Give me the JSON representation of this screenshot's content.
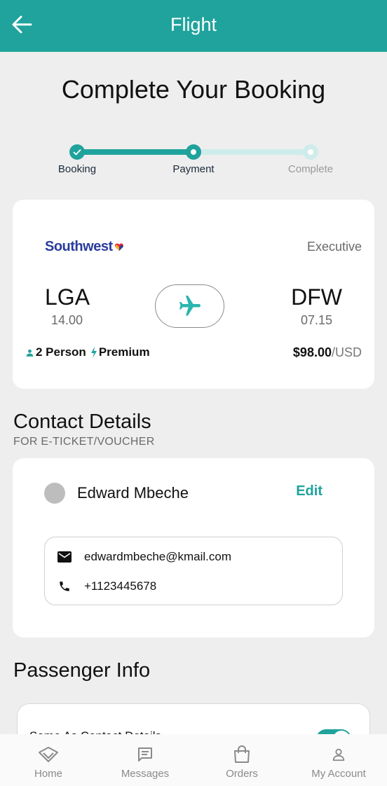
{
  "appbar": {
    "title": "Flight",
    "back_icon": "arrow-left-icon"
  },
  "page_title": "Complete Your Booking",
  "stepper": {
    "steps": [
      {
        "label": "Booking",
        "state": "done"
      },
      {
        "label": "Payment",
        "state": "current"
      },
      {
        "label": "Complete",
        "state": "pending"
      }
    ]
  },
  "flight": {
    "airline": "Southwest",
    "cabin_class": "Executive",
    "from": {
      "code": "LGA",
      "time": "14.00"
    },
    "to": {
      "code": "DFW",
      "time": "07.15"
    },
    "passengers": "2 Person",
    "fare": "Premium",
    "price": "$98.00",
    "currency": "/USD"
  },
  "contact": {
    "title": "Contact Details",
    "subtitle": "FOR E-TICKET/VOUCHER",
    "name": "Edward Mbeche",
    "edit_label": "Edit",
    "email": "edwardmbeche@kmail.com",
    "phone": "+1123445678"
  },
  "passenger": {
    "title": "Passenger Info",
    "same_as_label": "Same As Contact Details",
    "same_as_enabled": true
  },
  "nav": {
    "items": [
      {
        "label": "Home",
        "icon": "home-icon"
      },
      {
        "label": "Messages",
        "icon": "messages-icon"
      },
      {
        "label": "Orders",
        "icon": "shopping-bag-icon"
      },
      {
        "label": "My Account",
        "icon": "user-icon"
      }
    ]
  },
  "colors": {
    "accent": "#1fa39c",
    "accent_light": "#cfeceb",
    "background": "#eeeeee"
  }
}
